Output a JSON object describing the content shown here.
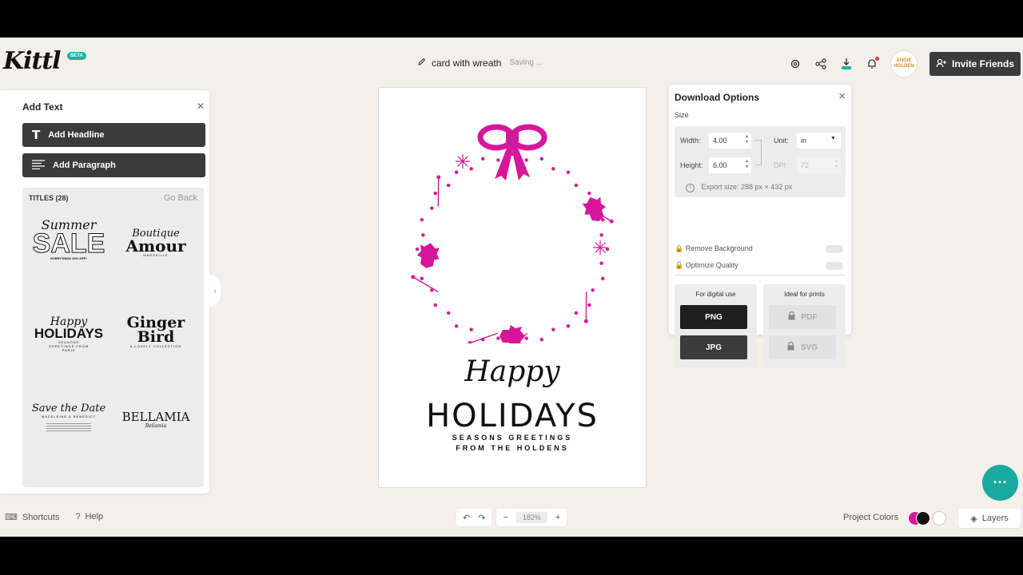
{
  "app": {
    "logo": "Kittl",
    "badge": "BETA"
  },
  "header": {
    "doc_title": "card with wreath",
    "status": "Saving ...",
    "icons": [
      "gear-icon",
      "share-icon",
      "download-icon",
      "bell-icon"
    ],
    "avatar_text": "ANGIE HOLDEN",
    "invite_label": "Invite Friends"
  },
  "left_panel": {
    "title": "Add Text",
    "add_headline": "Add Headline",
    "add_paragraph": "Add Paragraph",
    "titles_header": "TITLES (28)",
    "go_back": "Go Back",
    "templates": [
      {
        "line1": "Summer",
        "line2": "SALE",
        "line3": "EVERYTHING 40% OFF!"
      },
      {
        "line1": "Boutique",
        "line2": "Amour",
        "line3": "MARSEILLE"
      },
      {
        "line1": "Happy",
        "line2": "HOLIDAYS",
        "line3": "SEASONS GREETINGS FROM PARIS"
      },
      {
        "line1": "Ginger",
        "line2": "Bird",
        "line3": "A LOVELY COLLECTION"
      },
      {
        "line1": "Save the Date",
        "line2": "",
        "line3": "MADELEINE & BENEDICT"
      },
      {
        "line1": "BELLAMIA",
        "line2": "",
        "line3": "Bellamia"
      }
    ]
  },
  "canvas": {
    "accent": "#d6179b",
    "happy": "Happy",
    "holidays": "HOLIDAYS",
    "seasons": "SEASONS GREETINGS",
    "from": "FROM THE HOLDENS"
  },
  "download": {
    "title": "Download Options",
    "size_label": "Size",
    "width_label": "Width:",
    "width_value": "4.00",
    "height_label": "Height:",
    "height_value": "6.00",
    "unit_label": "Unit:",
    "unit_value": "in",
    "dpi_label": "DPI:",
    "dpi_value": "72",
    "export_size": "Export size: 288 px × 432 px",
    "remove_bg": "Remove Background",
    "optimize": "Optimize Quality",
    "digital_header": "For digital use",
    "print_header": "Ideal for prints",
    "png": "PNG",
    "jpg": "JPG",
    "pdf": "PDF",
    "svg": "SVG"
  },
  "bottom": {
    "shortcuts": "Shortcuts",
    "help": "Help",
    "zoom": "182%",
    "project_colors": "Project Colors",
    "layers": "Layers",
    "swatch_colors": [
      "#d6179b",
      "#111111",
      "#ffffff"
    ]
  }
}
